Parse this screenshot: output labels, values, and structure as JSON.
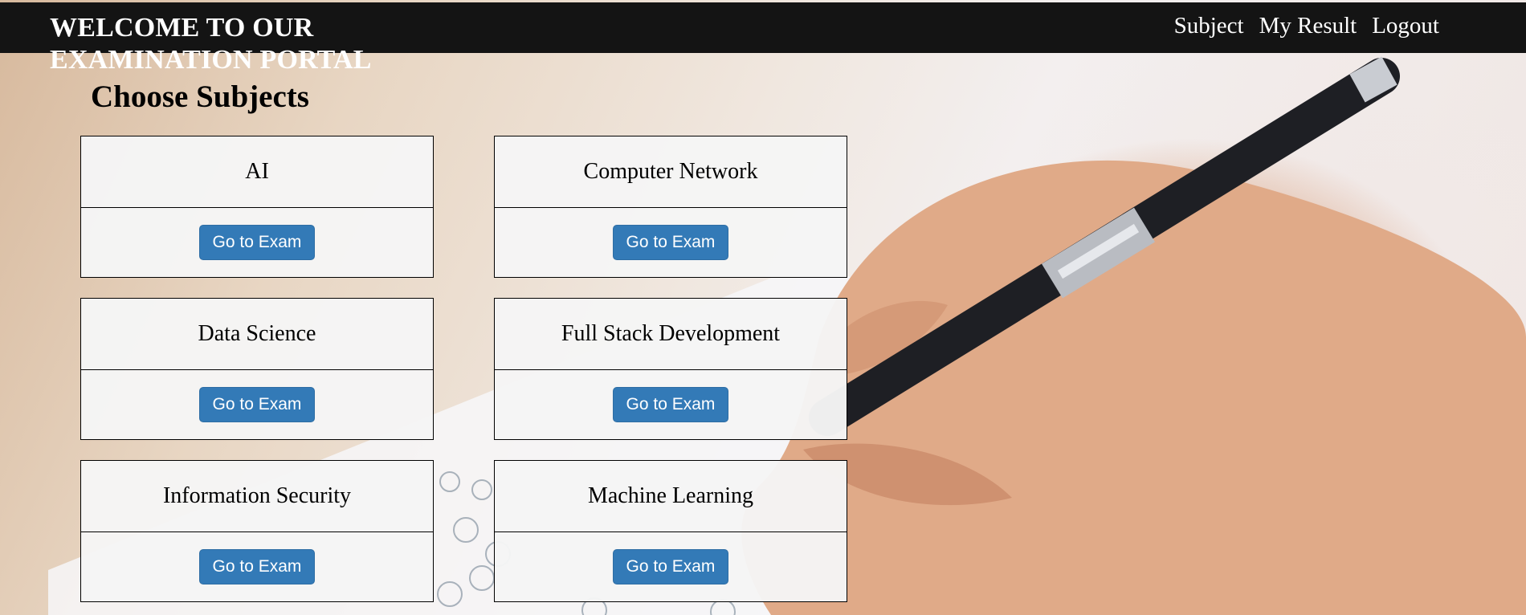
{
  "header": {
    "title": "WELCOME TO OUR EXAMINATION PORTAL",
    "nav": [
      {
        "label": "Subject"
      },
      {
        "label": "My Result"
      },
      {
        "label": "Logout"
      }
    ]
  },
  "main": {
    "heading": "Choose Subjects",
    "subjects": [
      {
        "name": "AI",
        "button": "Go to Exam"
      },
      {
        "name": "Computer Network",
        "button": "Go to Exam"
      },
      {
        "name": "Data Science",
        "button": "Go to Exam"
      },
      {
        "name": "Full Stack Development",
        "button": "Go to Exam"
      },
      {
        "name": "Information Security",
        "button": "Go to Exam"
      },
      {
        "name": "Machine Learning",
        "button": "Go to Exam"
      }
    ]
  },
  "colors": {
    "header_bg": "#141414",
    "button_bg": "#337ab7",
    "card_bg": "#f5f5f5"
  },
  "background": {
    "description_icon": "hand-writing-exam-photo"
  }
}
